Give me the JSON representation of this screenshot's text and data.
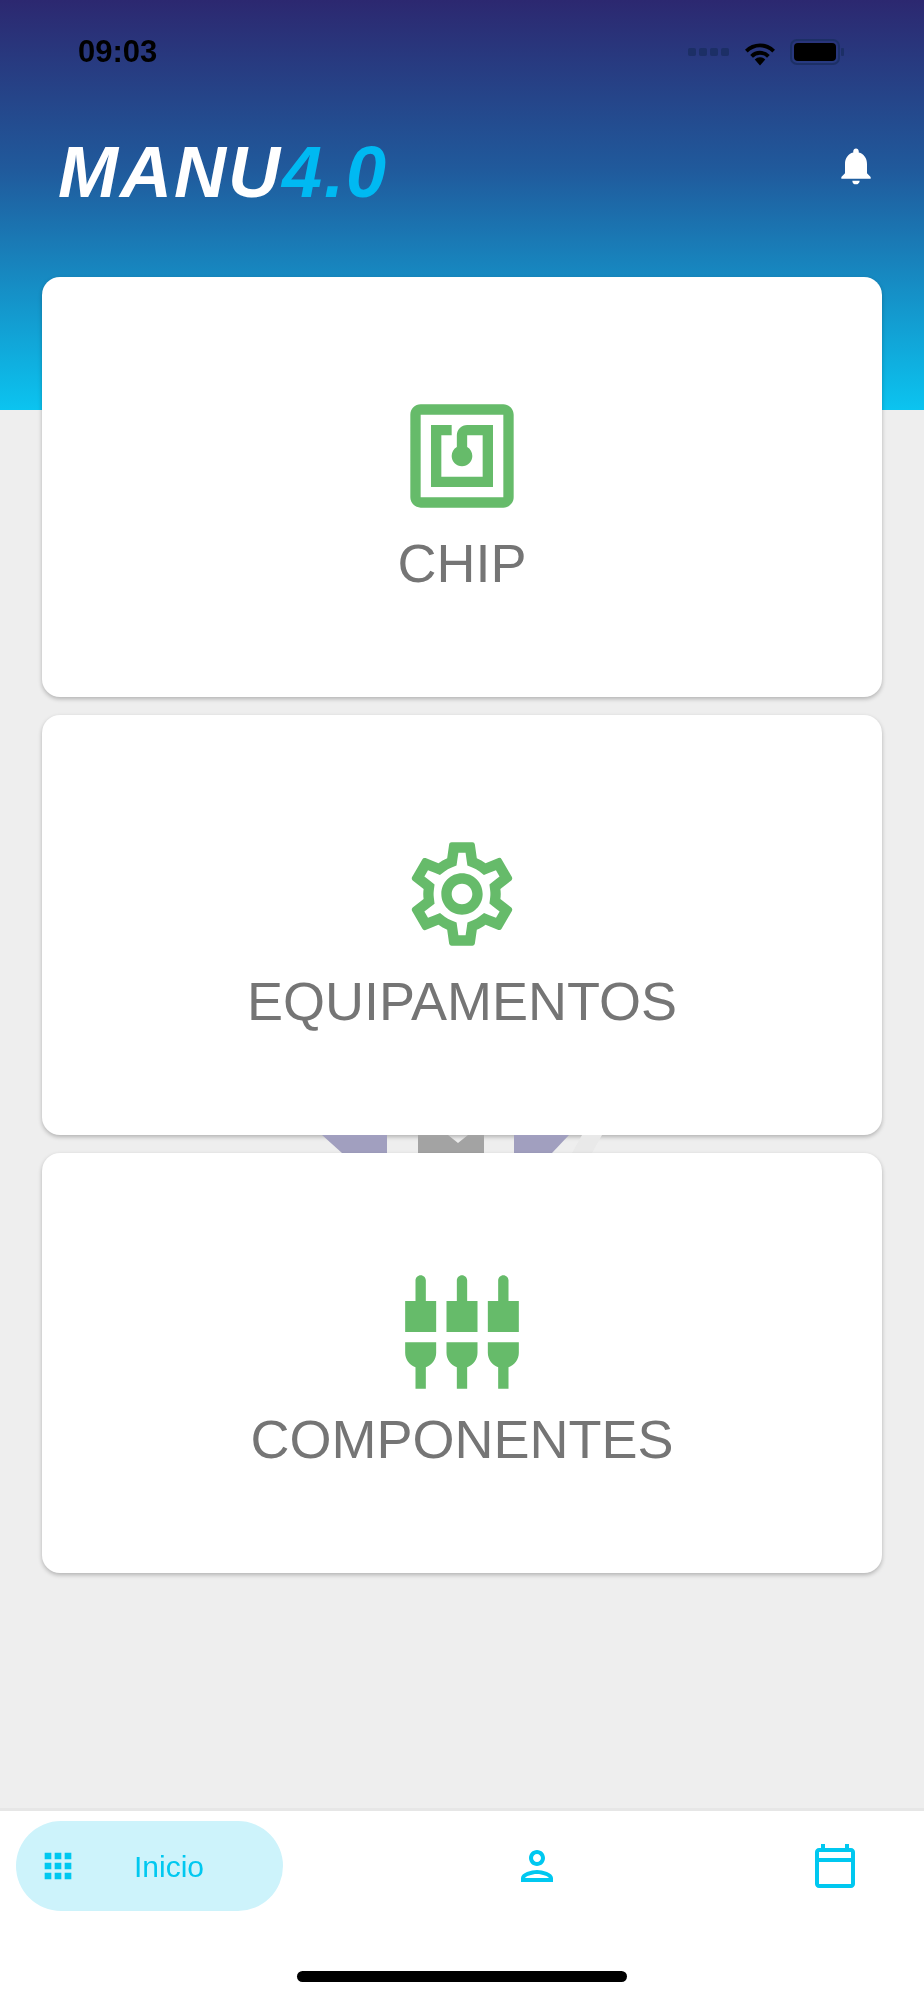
{
  "status_bar": {
    "time": "09:03"
  },
  "header": {
    "logo": {
      "main": "MANU",
      "accent": "4.0"
    }
  },
  "cards": [
    {
      "kind": "chip",
      "label": "CHIP"
    },
    {
      "kind": "gear",
      "label": "EQUIPAMENTOS"
    },
    {
      "kind": "plugs",
      "label": "COMPONENTES"
    }
  ],
  "nav": [
    {
      "kind": "grid",
      "label": "Inicio",
      "selected": true
    },
    {
      "kind": "person",
      "selected": false
    },
    {
      "kind": "calendar",
      "selected": false
    }
  ]
}
